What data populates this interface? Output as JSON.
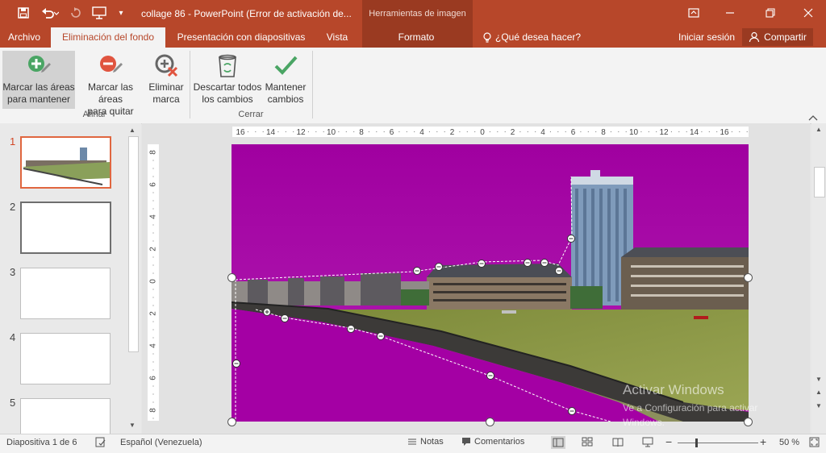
{
  "titlebar": {
    "title": "collage 86 - PowerPoint (Error de activación de...",
    "context_title": "Herramientas de imagen"
  },
  "tabs": [
    {
      "label": "Archivo"
    },
    {
      "label": "Eliminación del fondo"
    },
    {
      "label": "Presentación con diapositivas"
    },
    {
      "label": "Vista"
    },
    {
      "label": "Formato"
    }
  ],
  "tell_me": "¿Qué desea hacer?",
  "signin": "Iniciar sesión",
  "share": "Compartir",
  "ribbon": {
    "mark_keep_l1": "Marcar las áreas",
    "mark_keep_l2": "para mantener",
    "mark_remove_l1": "Marcar las áreas",
    "mark_remove_l2": "para quitar",
    "delete_mark_l1": "Eliminar",
    "delete_mark_l2": "marca",
    "discard_l1": "Descartar todos",
    "discard_l2": "los cambios",
    "keep_l1": "Mantener",
    "keep_l2": "cambios",
    "group_refine": "Afinar",
    "group_close": "Cerrar"
  },
  "slides": [
    {
      "num": "1"
    },
    {
      "num": "2"
    },
    {
      "num": "3"
    },
    {
      "num": "4"
    },
    {
      "num": "5"
    }
  ],
  "ruler_h": [
    "16",
    "14",
    "12",
    "10",
    "8",
    "6",
    "4",
    "2",
    "0",
    "2",
    "4",
    "6",
    "8",
    "10",
    "12",
    "14",
    "16"
  ],
  "ruler_v": [
    "8",
    "6",
    "4",
    "2",
    "0",
    "2",
    "4",
    "6",
    "8"
  ],
  "watermark": {
    "l1": "Activar Windows",
    "l2": "Ve a Configuración para activar",
    "l3": "Windows."
  },
  "status": {
    "slide_of": "Diapositiva 1 de 6",
    "language": "Español (Venezuela)",
    "notes": "Notas",
    "comments": "Comentarios",
    "zoom_minus": "−",
    "zoom_plus": "+",
    "zoom": "50 %",
    "zoom_fraction": 0.5
  },
  "colors": {
    "accent": "#b7472a",
    "removed": "#a300a3"
  }
}
